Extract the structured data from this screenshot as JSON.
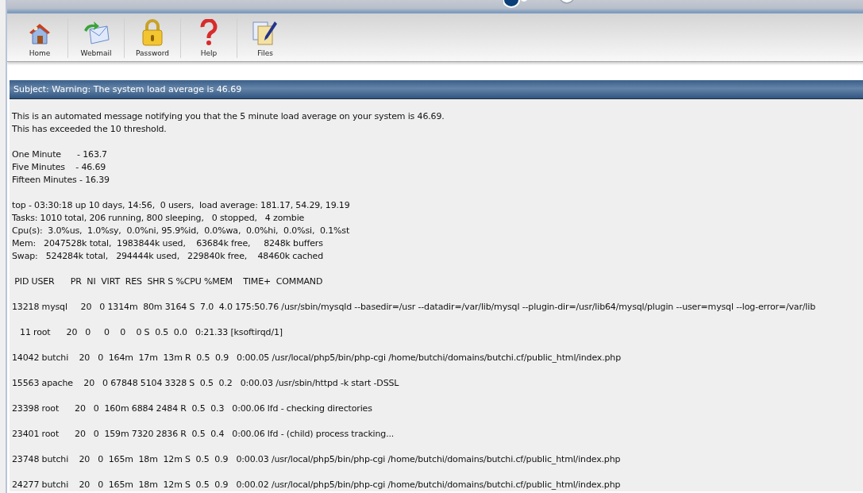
{
  "toolbar": [
    {
      "label": "Home",
      "kind": "home"
    },
    {
      "label": "Webmail",
      "kind": "mail"
    },
    {
      "label": "Password",
      "kind": "lock"
    },
    {
      "label": "Help",
      "kind": "help"
    },
    {
      "label": "Files",
      "kind": "files"
    }
  ],
  "subject": "Subject: Warning: The system load average is 46.69",
  "message": [
    "This is an automated message notifying you that the 5 minute load average on your system is 46.69.",
    "This has exceeded the 10 threshold."
  ],
  "load_averages": [
    "One Minute      - 163.7",
    "Five Minutes    - 46.69",
    "Fifteen Minutes - 16.39"
  ],
  "top_summary": [
    "top - 03:30:18 up 10 days, 14:56,  0 users,  load average: 181.17, 54.29, 19.19",
    "Tasks: 1010 total, 206 running, 800 sleeping,   0 stopped,   4 zombie",
    "Cpu(s):  3.0%us,  1.0%sy,  0.0%ni, 95.9%id,  0.0%wa,  0.0%hi,  0.0%si,  0.1%st",
    "Mem:   2047528k total,  1983844k used,    63684k free,     8248k buffers",
    "Swap:   524284k total,   294444k used,   229840k free,    48460k cached"
  ],
  "process_header": " PID USER      PR  NI  VIRT  RES  SHR S %CPU %MEM    TIME+  COMMAND",
  "processes": [
    "13218 mysql     20   0 1314m  80m 3164 S  7.0  4.0 175:50.76 /usr/sbin/mysqld --basedir=/usr --datadir=/var/lib/mysql --plugin-dir=/usr/lib64/mysql/plugin --user=mysql --log-error=/var/lib",
    "   11 root      20   0     0    0    0 S  0.5  0.0   0:21.33 [ksoftirqd/1]",
    "14042 butchi    20   0  164m  17m  13m R  0.5  0.9   0:00.05 /usr/local/php5/bin/php-cgi /home/butchi/domains/butchi.cf/public_html/index.php",
    "15563 apache    20   0 67848 5104 3328 S  0.5  0.2   0:00.03 /usr/sbin/httpd -k start -DSSL",
    "23398 root      20   0  160m 6884 2484 R  0.5  0.3   0:00.06 lfd - checking directories",
    "23401 root      20   0  159m 7320 2836 R  0.5  0.4   0:00.06 lfd - (child) process tracking...",
    "23748 butchi    20   0  165m  18m  12m S  0.5  0.9   0:00.03 /usr/local/php5/bin/php-cgi /home/butchi/domains/butchi.cf/public_html/index.php",
    "24277 butchi    20   0  165m  18m  12m S  0.5  0.9   0:00.02 /usr/local/php5/bin/php-cgi /home/butchi/domains/butchi.cf/public_html/index.php"
  ]
}
